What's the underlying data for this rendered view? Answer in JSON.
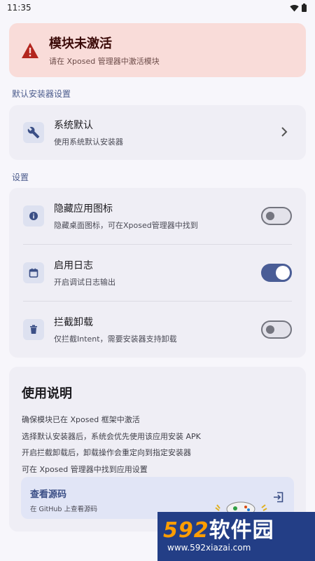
{
  "status_bar": {
    "time": "11:35"
  },
  "alert": {
    "title": "模块未激活",
    "subtitle": "请在 Xposed 管理器中激活模块"
  },
  "installer_section": {
    "label": "默认安装器设置",
    "item": {
      "title": "系统默认",
      "subtitle": "使用系统默认安装器",
      "icon": "wrench-icon"
    }
  },
  "settings_section": {
    "label": "设置",
    "items": [
      {
        "title": "隐藏应用图标",
        "subtitle": "隐藏桌面图标，可在Xposed管理器中找到",
        "icon": "info-icon",
        "enabled": false
      },
      {
        "title": "启用日志",
        "subtitle": "开启调试日志输出",
        "icon": "calendar-icon",
        "enabled": true
      },
      {
        "title": "拦截卸载",
        "subtitle": "仅拦截Intent，需要安装器支持卸载",
        "icon": "trash-icon",
        "enabled": false
      }
    ]
  },
  "guide": {
    "title": "使用说明",
    "lines": [
      "确保模块已在 Xposed 框架中激活",
      "选择默认安装器后，系统会优先使用该应用安装 APK",
      "开启拦截卸载后，卸载操作会重定向到指定安装器",
      "可在 Xposed 管理器中找到应用设置"
    ],
    "source": {
      "title": "查看源码",
      "subtitle": "在 GitHub 上查看源码"
    }
  },
  "watermark": {
    "num": "592",
    "text": "软件园",
    "url": "www.592xiazai.com"
  },
  "colors": {
    "accent": "#4a5d96",
    "alert_bg": "#f9dcd9",
    "warning": "#b3261e"
  }
}
